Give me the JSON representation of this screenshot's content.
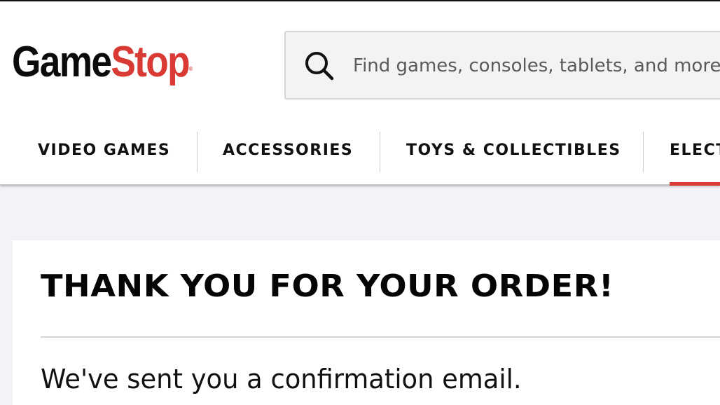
{
  "header": {
    "logo": {
      "part1": "Game",
      "part2": "Stop",
      "reg": "®"
    },
    "search": {
      "placeholder": "Find games, consoles, tablets, and more",
      "icon": "search-icon"
    },
    "nav": [
      {
        "label": "VIDEO GAMES"
      },
      {
        "label": "ACCESSORIES"
      },
      {
        "label": "TOYS & COLLECTIBLES"
      },
      {
        "label": "ELECT",
        "active": true
      }
    ]
  },
  "confirmation": {
    "title": "THANK YOU FOR YOUR ORDER!",
    "message": "We've sent you a confirmation email."
  },
  "colors": {
    "brand_red": "#d93a34",
    "text": "#0b0b0b",
    "page_bg": "#f2f3f6"
  }
}
